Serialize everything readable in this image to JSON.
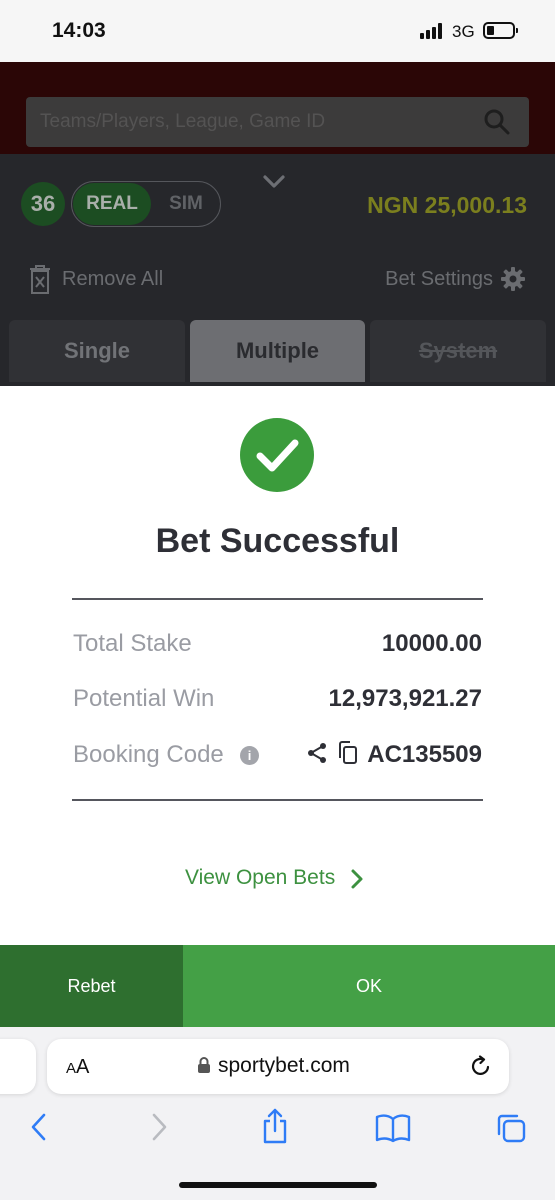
{
  "status_bar": {
    "time": "14:03",
    "network": "3G"
  },
  "app": {
    "search_placeholder": "Teams/Players, League, Game ID",
    "selection_count": "36",
    "mode_real": "REAL",
    "mode_sim": "SIM",
    "balance": "NGN 25,000.13",
    "remove_all": "Remove All",
    "bet_settings": "Bet Settings",
    "tabs": [
      "Single",
      "Multiple",
      "System"
    ],
    "active_tab": "Multiple"
  },
  "modal": {
    "title": "Bet Successful",
    "rows": [
      {
        "label": "Total Stake",
        "value": "10000.00"
      },
      {
        "label": "Potential Win",
        "value": "12,973,921.27"
      },
      {
        "label": "Booking Code",
        "value": "AC135509"
      }
    ],
    "view_open_bets": "View Open Bets",
    "accent_color": "#44a046"
  },
  "buttons": {
    "rebet": "Rebet",
    "ok": "OK"
  },
  "browser": {
    "aa_small": "A",
    "aa_big": "A",
    "url": "sportybet.com"
  }
}
